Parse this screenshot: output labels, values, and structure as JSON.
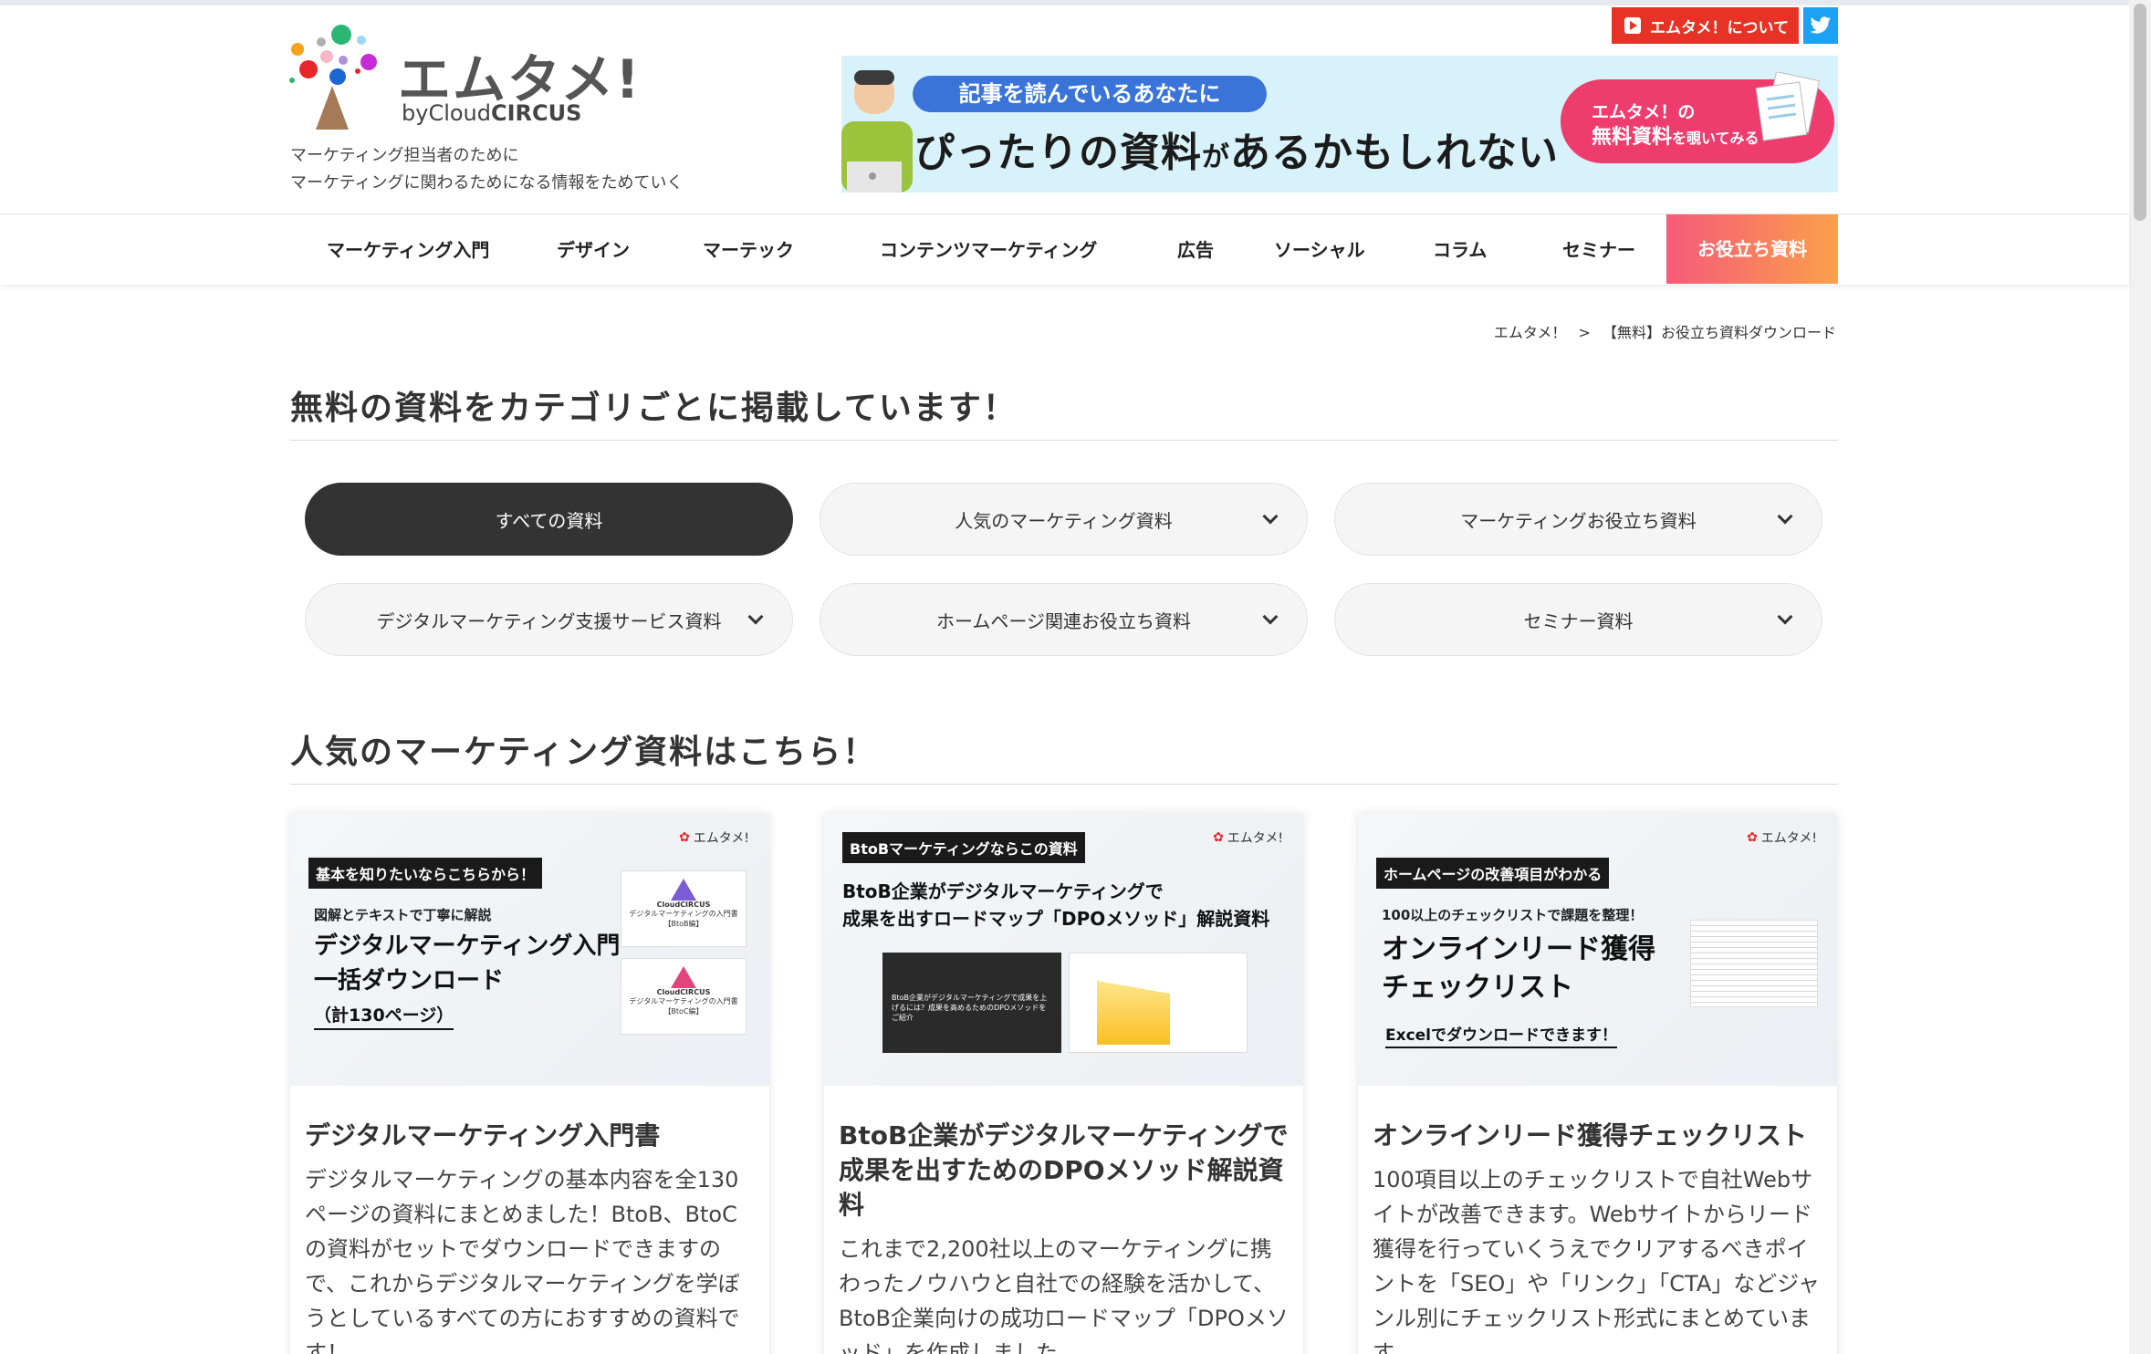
{
  "header": {
    "logo_text": "エムタメ!",
    "logo_by": "by",
    "logo_brand_light": "Cloud",
    "logo_brand_bold": "CIRCUS",
    "tagline_1": "マーケティング担当者のために",
    "tagline_2": "マーケティングに関わるためになる情報をためていく",
    "about_label": "エムタメ！について",
    "twitter_icon": "twitter-icon"
  },
  "banner": {
    "pill": "記事を読んでいるあなたに",
    "main_a": "ぴったりの資料",
    "main_b": "が",
    "main_c": "あるかもしれない",
    "cta_1": "エムタメ！の",
    "cta_2a": "無料資料",
    "cta_2b": "を覗いてみる"
  },
  "nav": {
    "items": [
      "マーケティング入門",
      "デザイン",
      "マーテック",
      "コンテンツマーケティング",
      "広告",
      "ソーシャル",
      "コラム",
      "セミナー"
    ],
    "cta": "お役立ち資料"
  },
  "breadcrumb": {
    "home": "エムタメ！",
    "sep": ">",
    "current": "【無料】お役立ち資料ダウンロード"
  },
  "section1": {
    "title": "無料の資料をカテゴリごとに掲載しています！"
  },
  "filters": [
    {
      "label": "すべての資料",
      "active": true
    },
    {
      "label": "人気のマーケティング資料"
    },
    {
      "label": "マーケティングお役立ち資料"
    },
    {
      "label": "デジタルマーケティング支援サービス資料"
    },
    {
      "label": "ホームページ関連お役立ち資料"
    },
    {
      "label": "セミナー資料"
    }
  ],
  "section2": {
    "title": "人気のマーケティング資料はこちら！"
  },
  "cards": [
    {
      "thumb_tag": "基本を知りたいならこちらから！",
      "thumb_sub": "図解とテキストで丁寧に解説",
      "thumb_big_1": "デジタルマーケティング入門",
      "thumb_big_2": "一括ダウンロード",
      "thumb_under": "（計130ページ）",
      "mini_logo": "エムタメ!",
      "book_brand": "CloudCIRCUS",
      "book_1": "デジタルマーケティングの入門書【BtoB編】",
      "book_2": "デジタルマーケティングの入門書【BtoC編】",
      "title": "デジタルマーケティング入門書",
      "desc": "デジタルマーケティングの基本内容を全130ページの資料にまとめました！BtoB、BtoCの資料がセットでダウンロードできますので、これからデジタルマーケティングを学ぼうとしているすべての方におすすめの資料です！"
    },
    {
      "thumb_tag": "BtoBマーケティングならこの資料",
      "thumb_big_1": "BtoB企業がデジタルマーケティングで",
      "thumb_big_2": "成果を出すロードマップ「DPOメソッド」解説資料",
      "mini_logo": "エムタメ!",
      "slide_text": "BtoB企業がデジタルマーケティングで成果を上げるには？成果を高めるためのDPOメソッドをご紹介",
      "title": "BtoB企業がデジタルマーケティングで成果を出すためのDPOメソッド解説資料",
      "desc": "これまで2,200社以上のマーケティングに携わったノウハウと自社での経験を活かして、BtoB企業向けの成功ロードマップ「DPOメソッド」を作成しました。"
    },
    {
      "thumb_tag": "ホームページの改善項目がわかる",
      "thumb_sub": "100以上のチェックリストで課題を整理！",
      "thumb_big_1": "オンラインリード獲得",
      "thumb_big_2": "チェックリスト",
      "thumb_under": "Excelでダウンロードできます！",
      "mini_logo": "エムタメ!",
      "title": "オンラインリード獲得チェックリスト",
      "desc": "100項目以上のチェックリストで自社Webサイトが改善できます。Webサイトからリード獲得を行っていくうえでクリアするべきポイントを「SEO」や「リンク」「CTA」などジャンル別にチェックリスト形式にまとめています。"
    }
  ],
  "colors": {
    "accent_red": "#e63325",
    "twitter": "#1da1f2",
    "active_chip": "#333333",
    "cta_gradient_start": "#f65a7a",
    "cta_gradient_end": "#fba04a",
    "banner_bg": "#d8f2fb"
  }
}
